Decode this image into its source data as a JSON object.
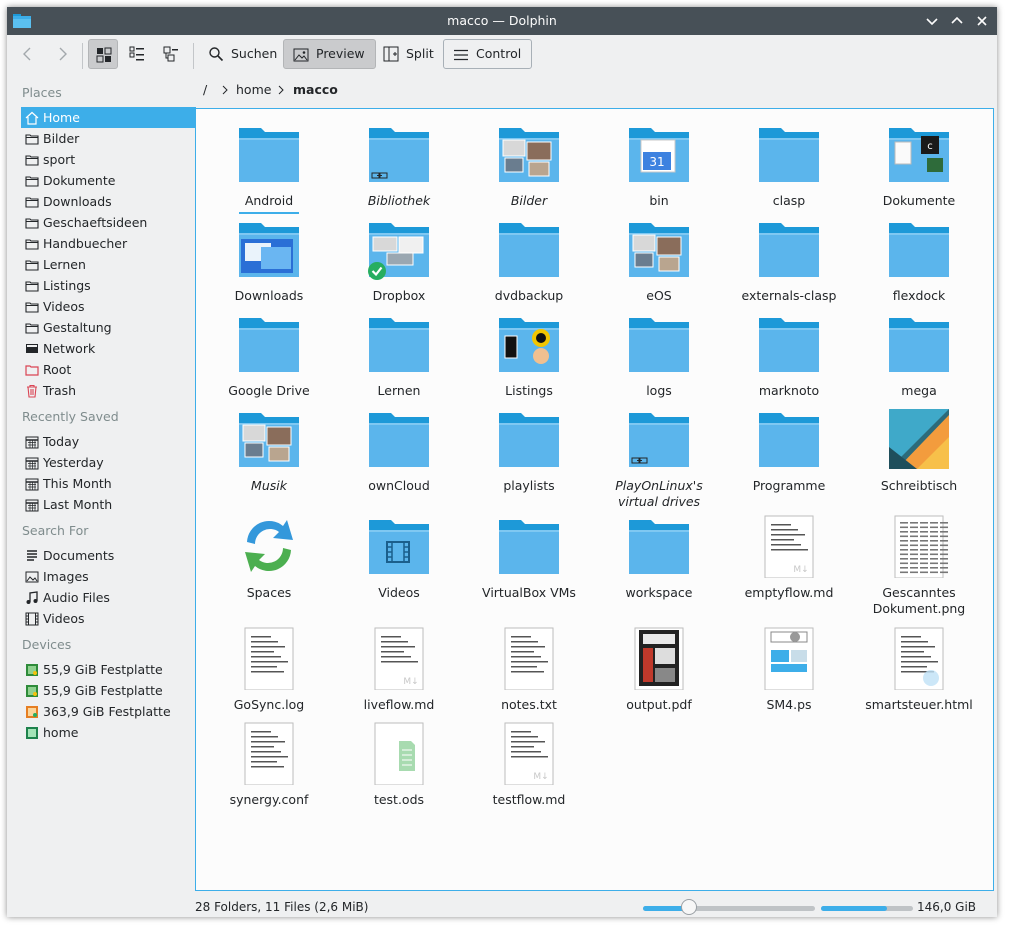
{
  "window": {
    "title": "macco — Dolphin"
  },
  "toolbar": {
    "search_label": "Suchen",
    "preview_label": "Preview",
    "split_label": "Split",
    "control_label": "Control"
  },
  "sidebar": {
    "places_title": "Places",
    "places": [
      "Home",
      "Bilder",
      "sport",
      "Dokumente",
      "Downloads",
      "Geschaeftsideen",
      "Handbuecher",
      "Lernen",
      "Listings",
      "Videos",
      "Gestaltung",
      "Network",
      "Root",
      "Trash"
    ],
    "recent_title": "Recently Saved",
    "recent": [
      "Today",
      "Yesterday",
      "This Month",
      "Last Month"
    ],
    "search_title": "Search For",
    "search": [
      "Documents",
      "Images",
      "Audio Files",
      "Videos"
    ],
    "devices_title": "Devices",
    "devices": [
      "55,9 GiB Festplatte",
      "55,9 GiB Festplatte",
      "363,9 GiB Festplatte",
      "home"
    ]
  },
  "breadcrumb": {
    "root": "/",
    "home": "home",
    "current": "macco"
  },
  "items": [
    {
      "label": "Android",
      "kind": "folder"
    },
    {
      "label": "Bibliothek",
      "kind": "folder-link"
    },
    {
      "label": "Bilder",
      "kind": "folder-images"
    },
    {
      "label": "bin",
      "kind": "folder-calendar"
    },
    {
      "label": "clasp",
      "kind": "folder"
    },
    {
      "label": "Dokumente",
      "kind": "folder-docs"
    },
    {
      "label": "Downloads",
      "kind": "folder-downloads"
    },
    {
      "label": "Dropbox",
      "kind": "folder-dropbox"
    },
    {
      "label": "dvdbackup",
      "kind": "folder"
    },
    {
      "label": "eOS",
      "kind": "folder-images"
    },
    {
      "label": "externals-clasp",
      "kind": "folder"
    },
    {
      "label": "flexdock",
      "kind": "folder"
    },
    {
      "label": "Google Drive",
      "kind": "folder"
    },
    {
      "label": "Lernen",
      "kind": "folder"
    },
    {
      "label": "Listings",
      "kind": "folder-listings"
    },
    {
      "label": "logs",
      "kind": "folder"
    },
    {
      "label": "marknoto",
      "kind": "folder"
    },
    {
      "label": "mega",
      "kind": "folder"
    },
    {
      "label": "Musik",
      "kind": "folder-images"
    },
    {
      "label": "ownCloud",
      "kind": "folder"
    },
    {
      "label": "playlists",
      "kind": "folder"
    },
    {
      "label": "PlayOnLinux's virtual drives",
      "kind": "folder-link"
    },
    {
      "label": "Programme",
      "kind": "folder"
    },
    {
      "label": "Schreibtisch",
      "kind": "wallpaper"
    },
    {
      "label": "Spaces",
      "kind": "spaces"
    },
    {
      "label": "Videos",
      "kind": "folder-video"
    },
    {
      "label": "VirtualBox VMs",
      "kind": "folder"
    },
    {
      "label": "workspace",
      "kind": "folder"
    },
    {
      "label": "emptyflow.md",
      "kind": "doc-md"
    },
    {
      "label": "Gescanntes Dokument.png",
      "kind": "doc-scan"
    },
    {
      "label": "GoSync.log",
      "kind": "doc"
    },
    {
      "label": "liveflow.md",
      "kind": "doc-md"
    },
    {
      "label": "notes.txt",
      "kind": "doc"
    },
    {
      "label": "output.pdf",
      "kind": "pdf"
    },
    {
      "label": "SM4.ps",
      "kind": "ps"
    },
    {
      "label": "smartsteuer.html",
      "kind": "html"
    },
    {
      "label": "synergy.conf",
      "kind": "doc"
    },
    {
      "label": "test.ods",
      "kind": "ods"
    },
    {
      "label": "testflow.md",
      "kind": "doc-md"
    }
  ],
  "status": {
    "summary": "28 Folders, 11 Files (2,6 MiB)",
    "zoom_fraction": 0.27,
    "space_used_fraction": 0.72,
    "free_space": "146,0 GiB free"
  },
  "colors": {
    "accent": "#3daee9",
    "titlebar": "#475057",
    "folder": "#5bb5ec",
    "folder_dark": "#1d99d8"
  }
}
